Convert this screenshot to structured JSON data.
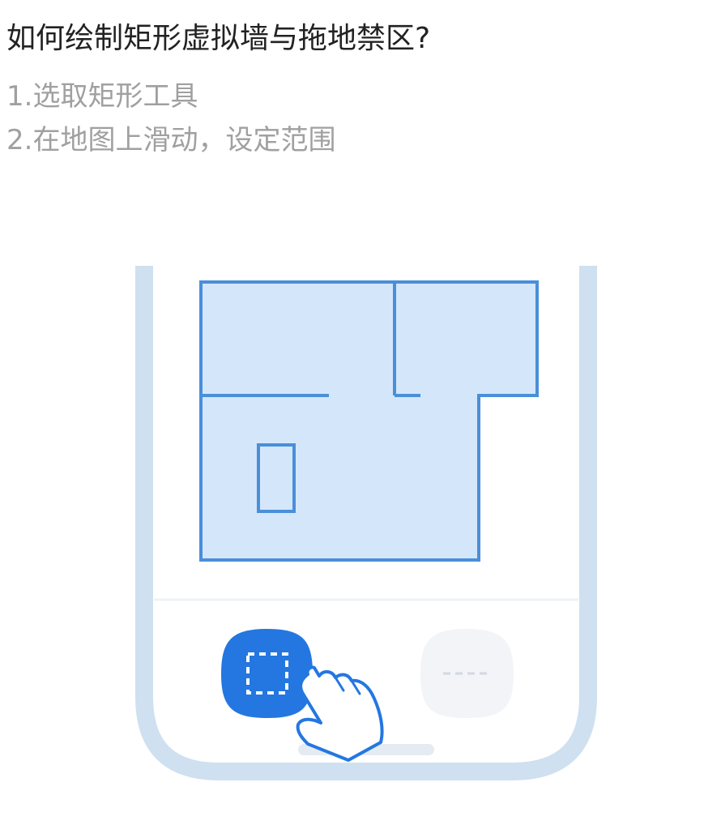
{
  "title": "如何绘制矩形虚拟墙与拖地禁区?",
  "steps": [
    "1.选取矩形工具",
    "2.在地图上滑动，设定范围"
  ],
  "illustration": {
    "tools": [
      {
        "icon": "rectangle-select-icon",
        "state": "selected"
      },
      {
        "icon": "dashed-line-icon",
        "state": "unselected"
      }
    ],
    "gesture": "hand-tap-icon",
    "colors": {
      "phone_frame": "#cfe0f0",
      "map_fill": "#d4e7fa",
      "map_wall": "#4a8fd9",
      "selected_tool": "#2477e0",
      "unselected_tool": "#f2f4f8"
    }
  }
}
